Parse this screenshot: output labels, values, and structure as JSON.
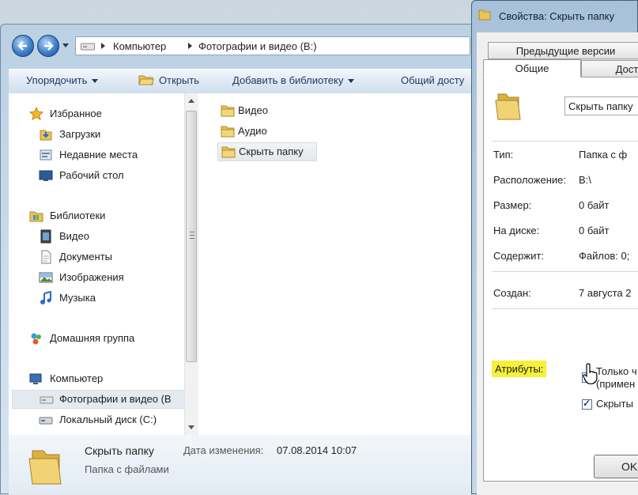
{
  "explorer": {
    "address": {
      "crumbs": [
        "Компьютер",
        "Фотографии и видео (B:)"
      ]
    },
    "toolbar": {
      "organize": "Упорядочить",
      "open": "Открыть",
      "add_library": "Добавить в библиотеку",
      "share": "Общий досту"
    },
    "nav": {
      "favorites": "Избранное",
      "downloads": "Загрузки",
      "recent": "Недавние места",
      "desktop": "Рабочий стол",
      "libraries": "Библиотеки",
      "video": "Видео",
      "documents": "Документы",
      "pictures": "Изображения",
      "music": "Музыка",
      "homegroup": "Домашняя группа",
      "computer": "Компьютер",
      "photos_drive": "Фотографии и видео (B",
      "local_disk": "Локальный диск (C:)"
    },
    "files": [
      "Видео",
      "Аудио",
      "Скрыть папку"
    ],
    "details": {
      "name": "Скрыть папку",
      "type": "Папка с файлами",
      "modified_label": "Дата изменения:",
      "modified_value": "07.08.2014 10:07"
    }
  },
  "properties": {
    "title": "Свойства: Скрыть папку",
    "tabs": {
      "previous_versions": "Предыдущие версии",
      "general": "Общие",
      "access": "Дост"
    },
    "name_value": "Скрыть папку",
    "rows": {
      "type_label": "Тип:",
      "type_value": "Папка с ф",
      "location_label": "Расположение:",
      "location_value": "B:\\",
      "size_label": "Размер:",
      "size_value": "0 байт",
      "ondisk_label": "На диске:",
      "ondisk_value": "0 байт",
      "contains_label": "Содержит:",
      "contains_value": "Файлов: 0;",
      "created_label": "Создан:",
      "created_value": "7 августа 2"
    },
    "attributes_label": "Атрибуты:",
    "readonly_label_1": "Только ч",
    "readonly_label_2": "(примен",
    "hidden_label": "Скрыты",
    "readonly_state": "indeterminate",
    "hidden_state": "checked",
    "ok_label": "OK"
  },
  "colors": {
    "highlight": "#f6f03a",
    "folder": "#e8c45a",
    "nav_button": "#3d7fc8"
  }
}
